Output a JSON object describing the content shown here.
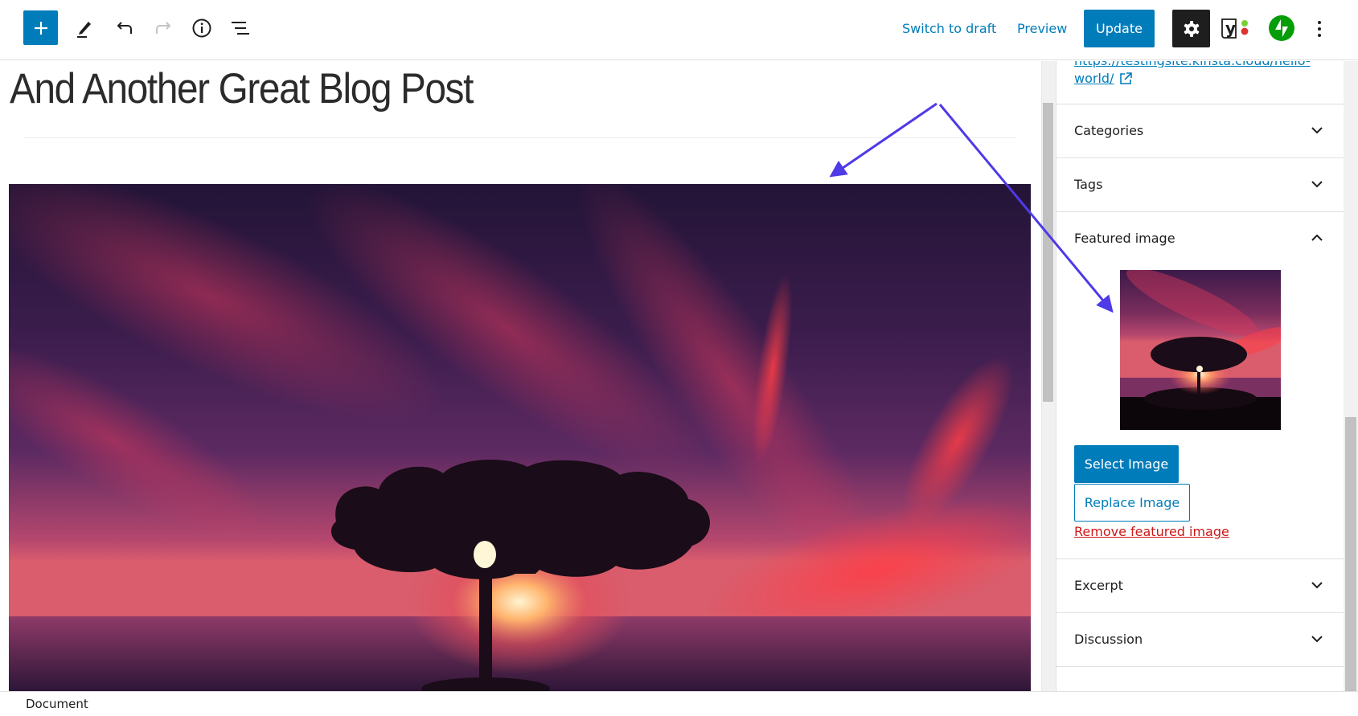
{
  "toolbar": {
    "add_block_label": "Add block",
    "tools_label": "Tools",
    "undo_label": "Undo",
    "redo_label": "Redo",
    "details_label": "Details",
    "outline_label": "List view",
    "switch_to_draft": "Switch to draft",
    "preview": "Preview",
    "update": "Update",
    "settings_label": "Settings",
    "yoast_label": "Yoast SEO",
    "jetpack_label": "Jetpack",
    "more_label": "Options"
  },
  "post": {
    "title": "And Another Great Blog Post",
    "hero_image_alt": "Silhouetted tree at sunset over the sea under red clouds"
  },
  "sidebar": {
    "permalink_line1": "https://testingsite.kinsta.cloud/hello-",
    "permalink_line2": "world/",
    "panels": [
      {
        "label": "Categories",
        "expanded": false
      },
      {
        "label": "Tags",
        "expanded": false
      },
      {
        "label": "Featured image",
        "expanded": true
      },
      {
        "label": "Excerpt",
        "expanded": false
      },
      {
        "label": "Discussion",
        "expanded": false
      }
    ],
    "featured_image": {
      "select_label": "Select Image",
      "replace_label": "Replace Image",
      "remove_label": "Remove featured image"
    }
  },
  "footer": {
    "breadcrumb": "Document"
  },
  "colors": {
    "accent": "#007cba",
    "danger": "#cc1818",
    "annotation_arrow": "#4f3ae8",
    "jetpack": "#069e08"
  }
}
